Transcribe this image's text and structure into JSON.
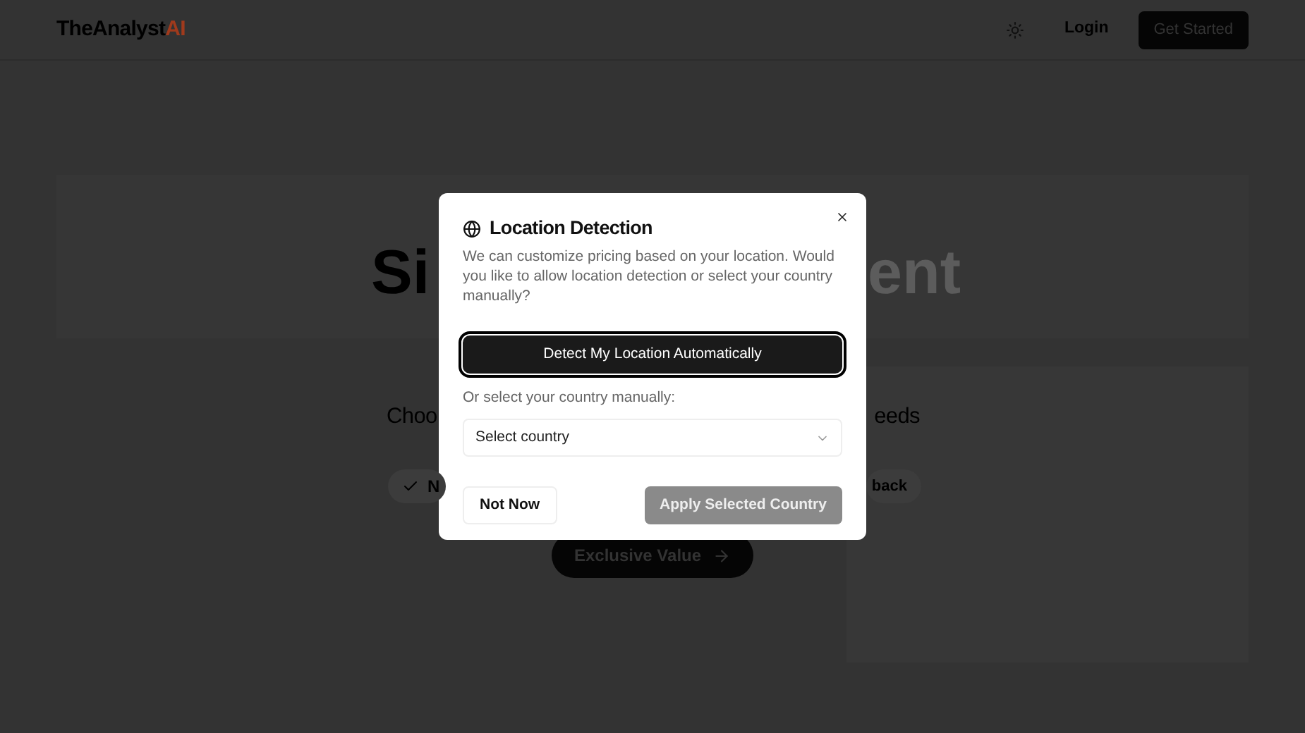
{
  "header": {
    "logo": {
      "main": "TheAnalyst",
      "accent": "AI"
    },
    "login": "Login",
    "cta": "Get Started"
  },
  "hero": {
    "heading_left": "Si",
    "heading_right": "ent",
    "subtitle_left": "Choo",
    "subtitle_right": "eeds",
    "pill_left": "N",
    "pill_right": "back",
    "button": "Exclusive Value"
  },
  "dialog": {
    "title": "Location Detection",
    "description": "We can customize pricing based on your location. Would you like to allow location detection or select your country manually?",
    "detect_button": "Detect My Location Automatically",
    "manual_label": "Or select your country manually:",
    "country_select": {
      "placeholder": "Select country"
    },
    "buttons": [
      {
        "label": "Not Now",
        "kind": "outline",
        "disabled": false
      },
      {
        "label": "Apply Selected Country",
        "kind": "primary",
        "disabled": true
      }
    ]
  }
}
